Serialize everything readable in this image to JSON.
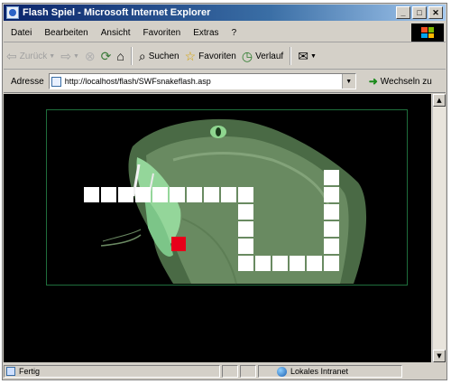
{
  "window": {
    "title": "Flash Spiel - Microsoft Internet Explorer"
  },
  "menu": [
    "Datei",
    "Bearbeiten",
    "Ansicht",
    "Favoriten",
    "Extras",
    "?"
  ],
  "toolbar": {
    "back_label": "Zurück",
    "search_label": "Suchen",
    "favorites_label": "Favoriten",
    "history_label": "Verlauf"
  },
  "address": {
    "label": "Adresse",
    "url": "http://localhost/flash/SWFsnakeflash.asp",
    "go_label": "Wechseln zu"
  },
  "status": {
    "text": "Fertig",
    "zone": "Lokales Intranet"
  },
  "game": {
    "snake_color": "#ffffff",
    "food_color": "#e8001a",
    "frame_color": "#1f6e3c",
    "snake_head": [
      0,
      0
    ],
    "food": [
      5,
      3
    ]
  }
}
